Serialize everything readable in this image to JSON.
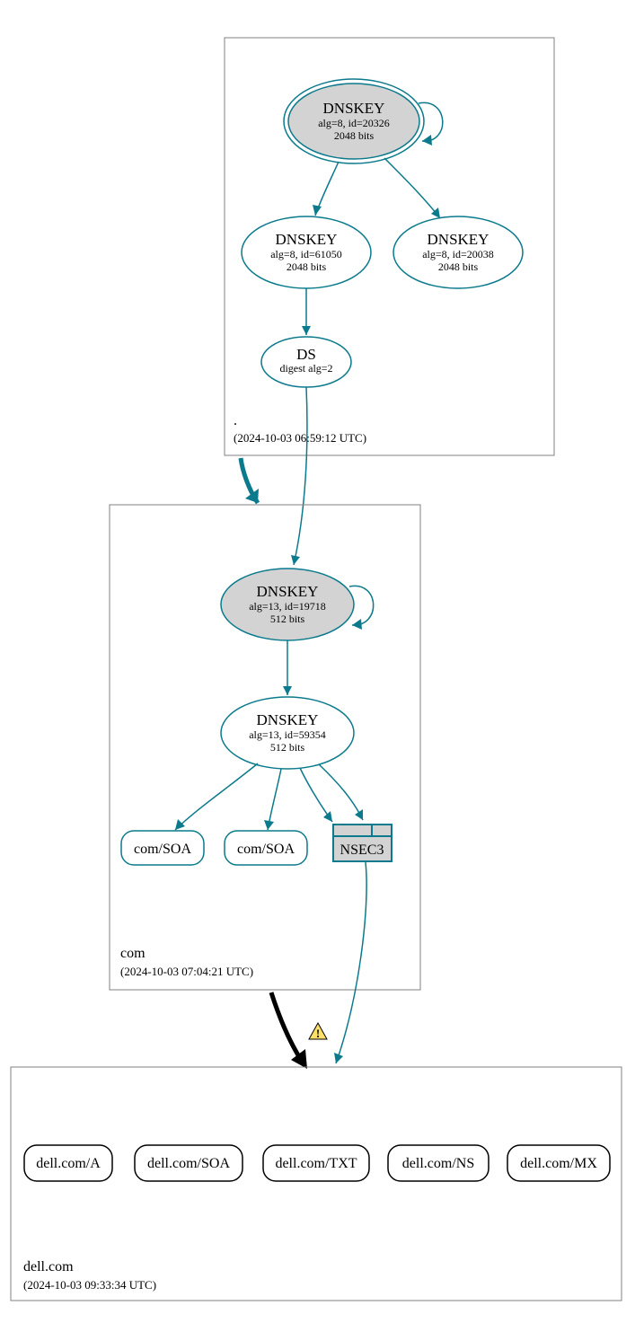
{
  "colors": {
    "stroke_teal": "#0a7a8c",
    "fill_grey": "#d3d3d3"
  },
  "zones": {
    "root": {
      "label": ".",
      "timestamp": "(2024-10-03 06:59:12 UTC)"
    },
    "com": {
      "label": "com",
      "timestamp": "(2024-10-03 07:04:21 UTC)"
    },
    "leaf": {
      "label": "dell.com",
      "timestamp": "(2024-10-03 09:33:34 UTC)"
    }
  },
  "root_nodes": {
    "ksk": {
      "title": "DNSKEY",
      "line2": "alg=8, id=20326",
      "line3": "2048 bits"
    },
    "zsk": {
      "title": "DNSKEY",
      "line2": "alg=8, id=61050",
      "line3": "2048 bits"
    },
    "extra": {
      "title": "DNSKEY",
      "line2": "alg=8, id=20038",
      "line3": "2048 bits"
    },
    "ds": {
      "title": "DS",
      "line2": "digest alg=2"
    }
  },
  "com_nodes": {
    "ksk": {
      "title": "DNSKEY",
      "line2": "alg=13, id=19718",
      "line3": "512 bits"
    },
    "zsk": {
      "title": "DNSKEY",
      "line2": "alg=13, id=59354",
      "line3": "512 bits"
    },
    "soa1": "com/SOA",
    "soa2": "com/SOA",
    "nsec3": "NSEC3"
  },
  "leaf_records": {
    "a": "dell.com/A",
    "soa": "dell.com/SOA",
    "txt": "dell.com/TXT",
    "ns": "dell.com/NS",
    "mx": "dell.com/MX"
  }
}
